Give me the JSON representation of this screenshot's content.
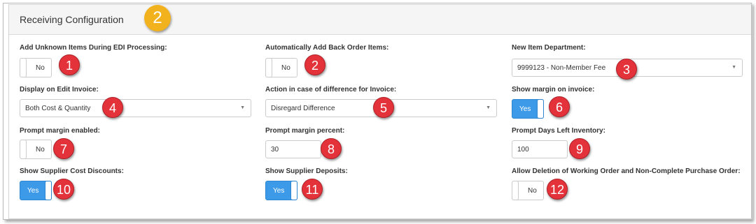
{
  "panel": {
    "title": "Receiving Configuration",
    "step": "2"
  },
  "fields": {
    "f1": {
      "label": "Add Unknown Items During EDI Processing:",
      "value": "No",
      "badge": "1"
    },
    "f2": {
      "label": "Automatically Add Back Order Items:",
      "value": "No",
      "badge": "2"
    },
    "f3": {
      "label": "New Item Department:",
      "value": "9999123 - Non-Member Fee",
      "badge": "3"
    },
    "f4": {
      "label": "Display on Edit Invoice:",
      "value": "Both Cost & Quantity",
      "badge": "4"
    },
    "f5": {
      "label": "Action in case of difference for Invoice:",
      "value": "Disregard Difference",
      "badge": "5"
    },
    "f6": {
      "label": "Show margin on invoice:",
      "value": "Yes",
      "badge": "6"
    },
    "f7": {
      "label": "Prompt margin enabled:",
      "value": "No",
      "badge": "7"
    },
    "f8": {
      "label": "Prompt margin percent:",
      "value": "30",
      "badge": "8"
    },
    "f9": {
      "label": "Prompt Days Left Inventory:",
      "value": "100",
      "badge": "9"
    },
    "f10": {
      "label": "Show Supplier Cost Discounts:",
      "value": "Yes",
      "badge": "10"
    },
    "f11": {
      "label": "Show Supplier Deposits:",
      "value": "Yes",
      "badge": "11"
    },
    "f12": {
      "label": "Allow Deletion of Working Order and Non-Complete Purchase Order:",
      "value": "No",
      "badge": "12"
    }
  },
  "colors": {
    "toggle_on": "#3d9ae8",
    "badge_red": "#e3323a",
    "badge_step": "#f2b21e"
  }
}
